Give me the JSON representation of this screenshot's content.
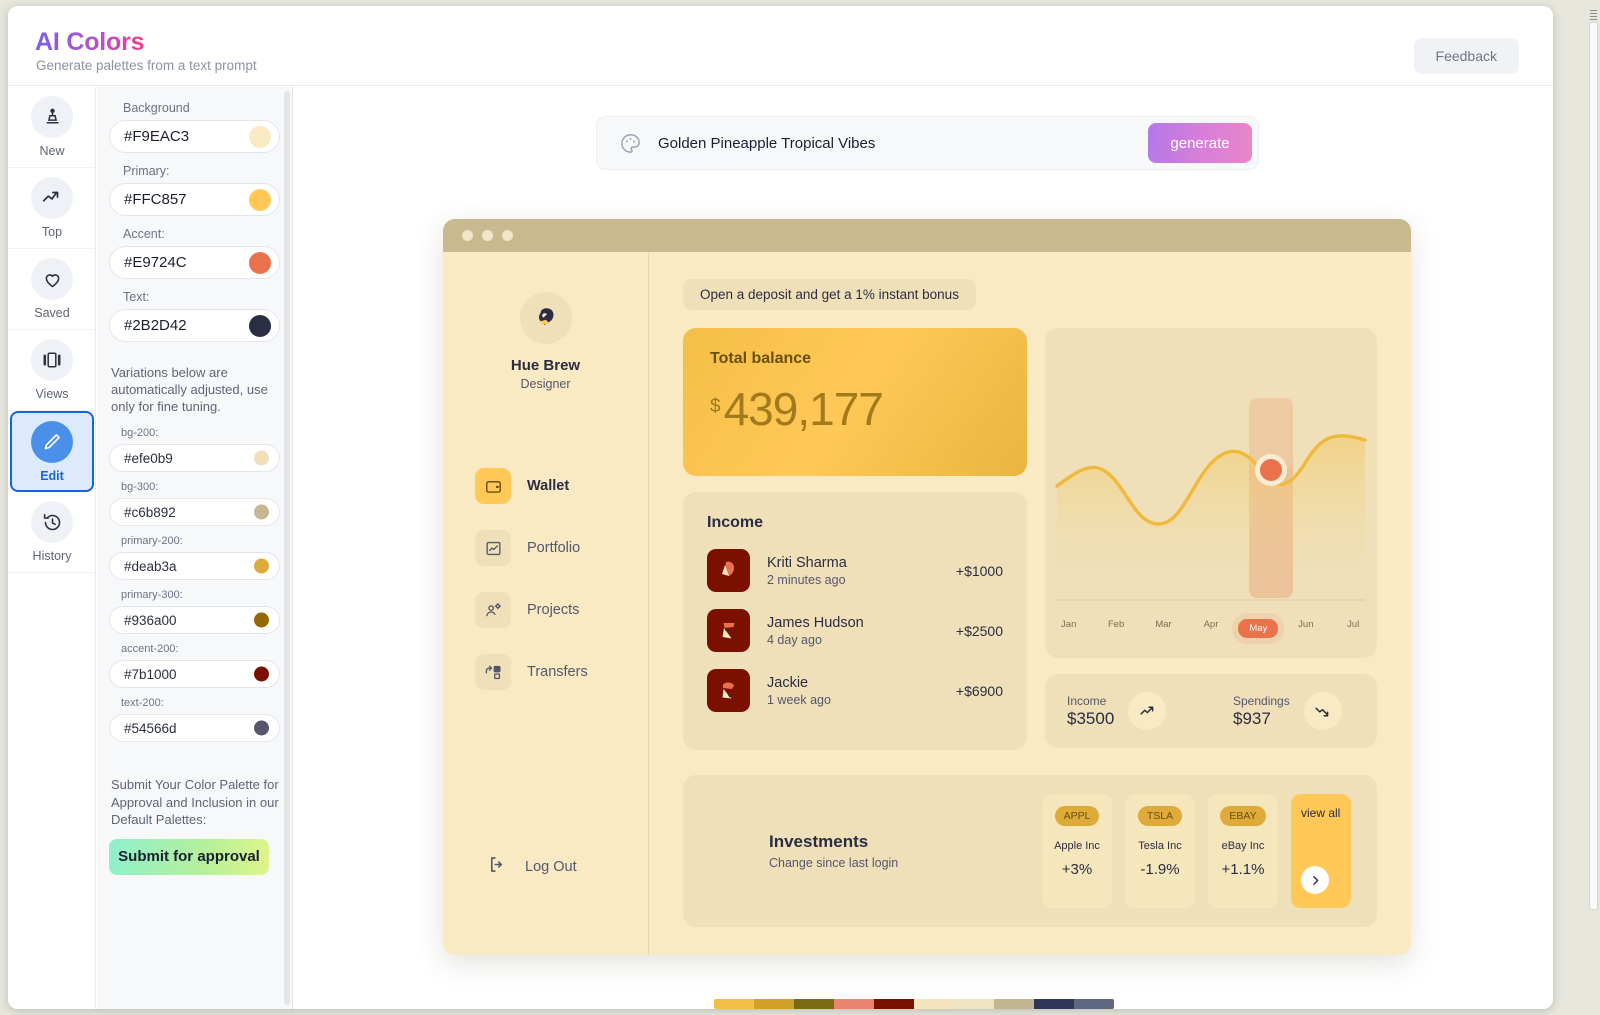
{
  "header": {
    "title": "AI Colors",
    "subtitle": "Generate palettes from a text prompt",
    "feedback_label": "Feedback"
  },
  "rail": {
    "items": [
      {
        "label": "New",
        "icon": "stamp-icon",
        "active": false
      },
      {
        "label": "Top",
        "icon": "trending-up-icon",
        "active": false
      },
      {
        "label": "Saved",
        "icon": "heart-icon",
        "active": false
      },
      {
        "label": "Views",
        "icon": "carousel-icon",
        "active": false
      },
      {
        "label": "Edit",
        "icon": "pencil-icon",
        "active": true
      },
      {
        "label": "History",
        "icon": "history-icon",
        "active": false
      }
    ]
  },
  "palette": {
    "core": [
      {
        "label": "Background",
        "hex": "#F9EAC3",
        "color": "#f9eac3"
      },
      {
        "label": "Primary:",
        "hex": "#FFC857",
        "color": "#ffc857"
      },
      {
        "label": "Accent:",
        "hex": "#E9724C",
        "color": "#e9724c"
      },
      {
        "label": "Text:",
        "hex": "#2B2D42",
        "color": "#2b2d42"
      }
    ],
    "variations_note": "Variations below are automatically adjusted, use only for fine tuning.",
    "variations": [
      {
        "label": "bg-200:",
        "hex": "#efe0b9",
        "color": "#efe0b9"
      },
      {
        "label": "bg-300:",
        "hex": "#c6b892",
        "color": "#c6b892"
      },
      {
        "label": "primary-200:",
        "hex": "#deab3a",
        "color": "#deab3a"
      },
      {
        "label": "primary-300:",
        "hex": "#936a00",
        "color": "#936a00"
      },
      {
        "label": "accent-200:",
        "hex": "#7b1000",
        "color": "#7b1000"
      },
      {
        "label": "text-200:",
        "hex": "#54566d",
        "color": "#54566d"
      }
    ],
    "submit_note": "Submit Your Color Palette for Approval and Inclusion in our Default Palettes:",
    "submit_label": "Submit for approval"
  },
  "prompt": {
    "value": "Golden Pineapple Tropical Vibes",
    "generate_label": "generate"
  },
  "preview": {
    "profile": {
      "name": "Hue Brew",
      "role": "Designer"
    },
    "nav": [
      {
        "label": "Wallet",
        "icon": "wallet-icon",
        "active": true
      },
      {
        "label": "Portfolio",
        "icon": "chart-box-icon",
        "active": false
      },
      {
        "label": "Projects",
        "icon": "people-gear-icon",
        "active": false
      },
      {
        "label": "Transfers",
        "icon": "transfer-icon",
        "active": false
      }
    ],
    "logout_label": "Log Out",
    "deposit_banner": "Open a deposit and get a 1% instant bonus",
    "balance": {
      "label": "Total balance",
      "currency": "$",
      "amount": "439,177"
    },
    "income": {
      "title": "Income",
      "rows": [
        {
          "name": "Kriti Sharma",
          "time": "2 minutes ago",
          "amount": "+$1000"
        },
        {
          "name": "James Hudson",
          "time": "4 day ago",
          "amount": "+$2500"
        },
        {
          "name": "Jackie",
          "time": "1 week ago",
          "amount": "+$6900"
        }
      ]
    },
    "stats": [
      {
        "label": "Income",
        "value": "$3500",
        "icon": "trend-up-icon"
      },
      {
        "label": "Spendings",
        "value": "$937",
        "icon": "trend-down-icon"
      }
    ],
    "investments": {
      "title": "Investments",
      "subtitle": "Change since last login",
      "stocks": [
        {
          "ticker": "APPL",
          "name": "Apple Inc",
          "change": "+3%"
        },
        {
          "ticker": "TSLA",
          "name": "Tesla Inc",
          "change": "-1.9%"
        },
        {
          "ticker": "EBAY",
          "name": "eBay Inc",
          "change": "+1.1%"
        }
      ],
      "view_all_label": "view all"
    }
  },
  "chart_data": {
    "type": "area",
    "title": "",
    "xlabel": "",
    "ylabel": "",
    "categories": [
      "Jan",
      "Feb",
      "Mar",
      "Apr",
      "May",
      "Jun",
      "Jul"
    ],
    "values": [
      52,
      60,
      34,
      38,
      76,
      58,
      72
    ],
    "ylim": [
      0,
      100
    ],
    "grid": false,
    "legend": "none",
    "highlight_category": "May",
    "line_color": "#f0b93c",
    "marker_color": "#e9724c"
  },
  "bottom_strip": {
    "colors": [
      "#f2bf47",
      "#d2a127",
      "#7a6b12",
      "#ea8370",
      "#7b1000",
      "#f5e4bb",
      "#efe4c2",
      "#c3b492",
      "#2f3657",
      "#5d6781"
    ]
  }
}
